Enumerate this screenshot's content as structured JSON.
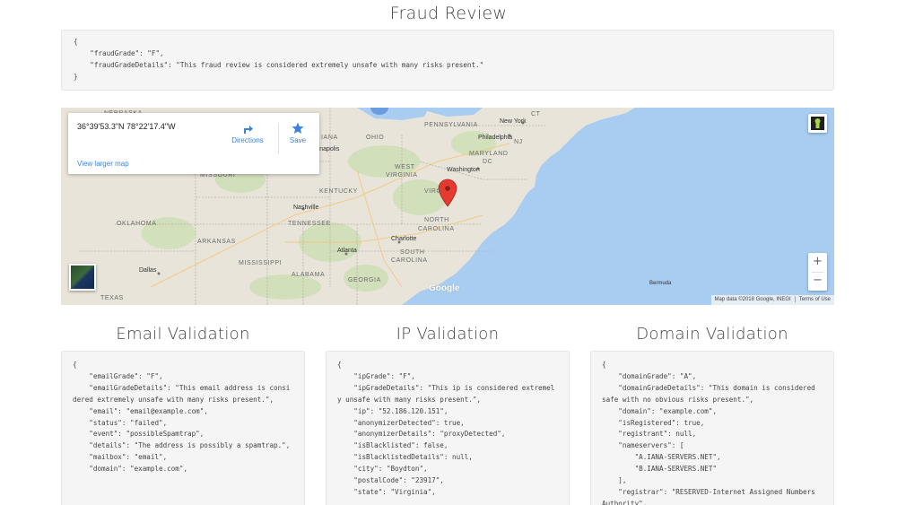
{
  "page_title": "Fraud Review",
  "fraud_json": "{\n    \"fraudGrade\": \"F\",\n    \"fraudGradeDetails\": \"This fraud review is considered extremely unsafe with many risks present.\"\n}",
  "map": {
    "coordinates": "36°39'53.3\"N 78°22'17.4\"W",
    "directions_label": "Directions",
    "save_label": "Save",
    "view_larger_label": "View larger map",
    "google_label": "Google",
    "attribution": "Map data ©2018 Google, INEGI",
    "terms": "Terms of Use",
    "zoom_in": "+",
    "zoom_out": "−",
    "labels": {
      "nebraska": "NEBRASKA",
      "ohio": "OHIO",
      "indiana": "IANA",
      "pennsylvania": "PENNSYLVANIA",
      "new_york": "New York",
      "philadelphia": "Philadelphia",
      "maryland": "MARYLAND",
      "washington": "Washington",
      "west_virginia_1": "WEST",
      "west_virginia_2": "VIRGINIA",
      "virginia": "VIRGI",
      "missouri": "MISSOURI",
      "kentucky": "KENTUCKY",
      "nashville": "Nashville",
      "tennessee": "TENNESSEE",
      "north_carolina_1": "NORTH",
      "north_carolina_2": "CAROLINA",
      "oklahoma": "OKLAHOMA",
      "arkansas": "ARKANSAS",
      "charlotte": "Charlotte",
      "atlanta": "Atlanta",
      "south_carolina_1": "SOUTH",
      "south_carolina_2": "CAROLINA",
      "mississippi": "MISSISSIPPI",
      "dallas": "Dallas",
      "alabama": "ALABAMA",
      "georgia": "GEORGIA",
      "texas": "TEXAS",
      "indianapolis": "Indianapolis",
      "bermuda": "Bermuda",
      "ct": "CT",
      "nj": "NJ",
      "dc": "DC"
    }
  },
  "email_title": "Email Validation",
  "ip_title": "IP Validation",
  "domain_title": "Domain Validation",
  "email_json": "{\n    \"emailGrade\": \"F\",\n    \"emailGradeDetails\": \"This email address is considered extremely unsafe with many risks present.\",\n    \"email\": \"email@example.com\",\n    \"status\": \"failed\",\n    \"event\": \"possibleSpamtrap\",\n    \"details\": \"The address is possibly a spamtrap.\",\n    \"mailbox\": \"email\",\n    \"domain\": \"example.com\",",
  "ip_json": "{\n    \"ipGrade\": \"F\",\n    \"ipGradeDetails\": \"This ip is considered extremely unsafe with many risks present.\",\n    \"ip\": \"52.186.120.151\",\n    \"anonymizerDetected\": true,\n    \"anonymizerDetails\": \"proxyDetected\",\n    \"isBlacklisted\": false,\n    \"isBlacklistedDetails\": null,\n    \"city\": \"Boydton\",\n    \"postalCode\": \"23917\",\n    \"state\": \"Virginia\",",
  "domain_json": "{\n    \"domainGrade\": \"A\",\n    \"domainGradeDetails\": \"This domain is considered safe with no obvious risks present.\",\n    \"domain\": \"example.com\",\n    \"isRegistered\": true,\n    \"registrant\": null,\n    \"nameservers\": [\n        \"A.IANA-SERVERS.NET\",\n        \"B.IANA-SERVERS.NET\"\n    ],\n    \"registrar\": \"RESERVED-Internet Assigned Numbers Authority\","
}
